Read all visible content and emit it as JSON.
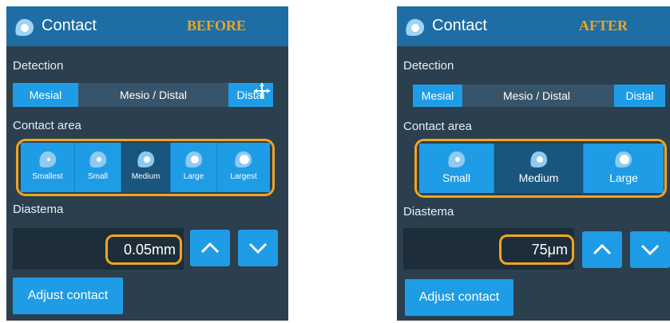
{
  "before": {
    "title": "Contact",
    "tag": "BEFORE",
    "detection_label": "Detection",
    "detection": [
      "Mesial",
      "Mesio / Distal",
      "Distal"
    ],
    "contact_area_label": "Contact area",
    "contact_options": [
      "Smallest",
      "Small",
      "Medium",
      "Large",
      "Largest"
    ],
    "selected_contact": "Medium",
    "diastema_label": "Diastema",
    "diastema_value": "0.05mm",
    "adjust_label": "Adjust contact"
  },
  "after": {
    "title": "Contact",
    "tag": "AFTER",
    "detection_label": "Detection",
    "detection": [
      "Mesial",
      "Mesio / Distal",
      "Distal"
    ],
    "contact_area_label": "Contact area",
    "contact_options": [
      "Small",
      "Medium",
      "Large"
    ],
    "selected_contact": "Medium",
    "diastema_label": "Diastema",
    "diastema_value": "75μm",
    "adjust_label": "Adjust contact"
  },
  "colors": {
    "panel": "#2c3f4e",
    "header": "#1e6da4",
    "accent": "#1f9ce6",
    "selected": "#1a557d",
    "highlight": "#f0a51e"
  },
  "icons": [
    "tooth-icon",
    "chevron-up-icon",
    "chevron-down-icon",
    "cursor-icon"
  ]
}
